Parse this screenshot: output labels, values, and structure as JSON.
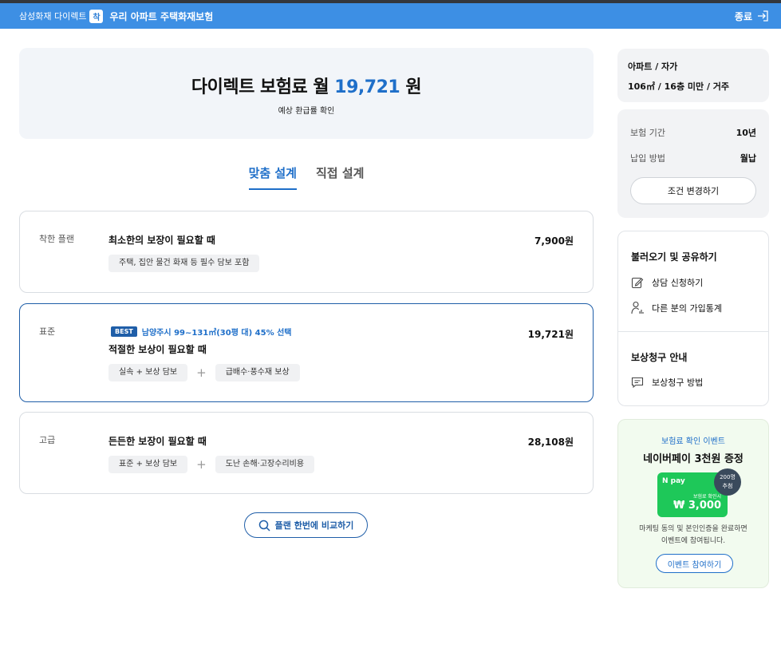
{
  "header": {
    "brand": "삼성화재 다이렉트",
    "brand_badge": "착",
    "product": "우리 아파트 주택화재보험",
    "exit_label": "종료"
  },
  "hero": {
    "prefix": "다이렉트 보험료 월",
    "amount": "19,721",
    "unit": "원",
    "sub": "예상 환급률 확인"
  },
  "tabs": [
    {
      "label": "맞춤 설계",
      "active": true
    },
    {
      "label": "직접 설계",
      "active": false
    }
  ],
  "plans": [
    {
      "type": "착한 플랜",
      "desc": "최소한의 보장이 필요할 때",
      "amount": "7,900원",
      "chips": [
        "주택, 집안 물건 화재 등 필수 담보 포함"
      ]
    },
    {
      "type": "표준",
      "best_badge": "BEST",
      "best_text": "남양주시 99~131㎡(30평 대) 45% 선택",
      "desc": "적절한 보상이 필요할 때",
      "amount": "19,721원",
      "chips": [
        "실속 + 보상 담보",
        "급배수·풍수재 보상"
      ]
    },
    {
      "type": "고급",
      "desc": "든든한 보장이 필요할 때",
      "amount": "28,108원",
      "chips": [
        "표준 + 보상 담보",
        "도난 손해·고장수리비용"
      ]
    }
  ],
  "compare_label": "플랜 한번에 비교하기",
  "sidebar": {
    "summary_line1": "아파트 / 자가",
    "summary_line2": "106㎡ / 16층 미만 / 거주",
    "conditions": [
      {
        "key": "보험 기간",
        "value": "10년"
      },
      {
        "key": "납입 방법",
        "value": "월납"
      }
    ],
    "change_label": "조건 변경하기",
    "share_title": "불러오기 및 공유하기",
    "share_links": [
      "상담 신청하기",
      "다른 분의 가입통계"
    ],
    "claim_title": "보상청구 안내",
    "claim_link": "보상청구 방법"
  },
  "event": {
    "title_small": "보험료 확인 이벤트",
    "title": "네이버페이 3천원 증정",
    "npay_logo": "N pay",
    "npay_label": "보험료 확인시",
    "npay_value": "₩ 3,000",
    "badge_line1": "200명",
    "badge_line2": "추첨",
    "desc_line1": "마케팅 동의 및 본인인증을 완료하면",
    "desc_line2": "이벤트에 참여됩니다.",
    "button": "이벤트 참여하기"
  },
  "colors": {
    "header_bg": "#3d8fe4",
    "accent": "#1f6fc9",
    "npay_green": "#1ec859"
  }
}
